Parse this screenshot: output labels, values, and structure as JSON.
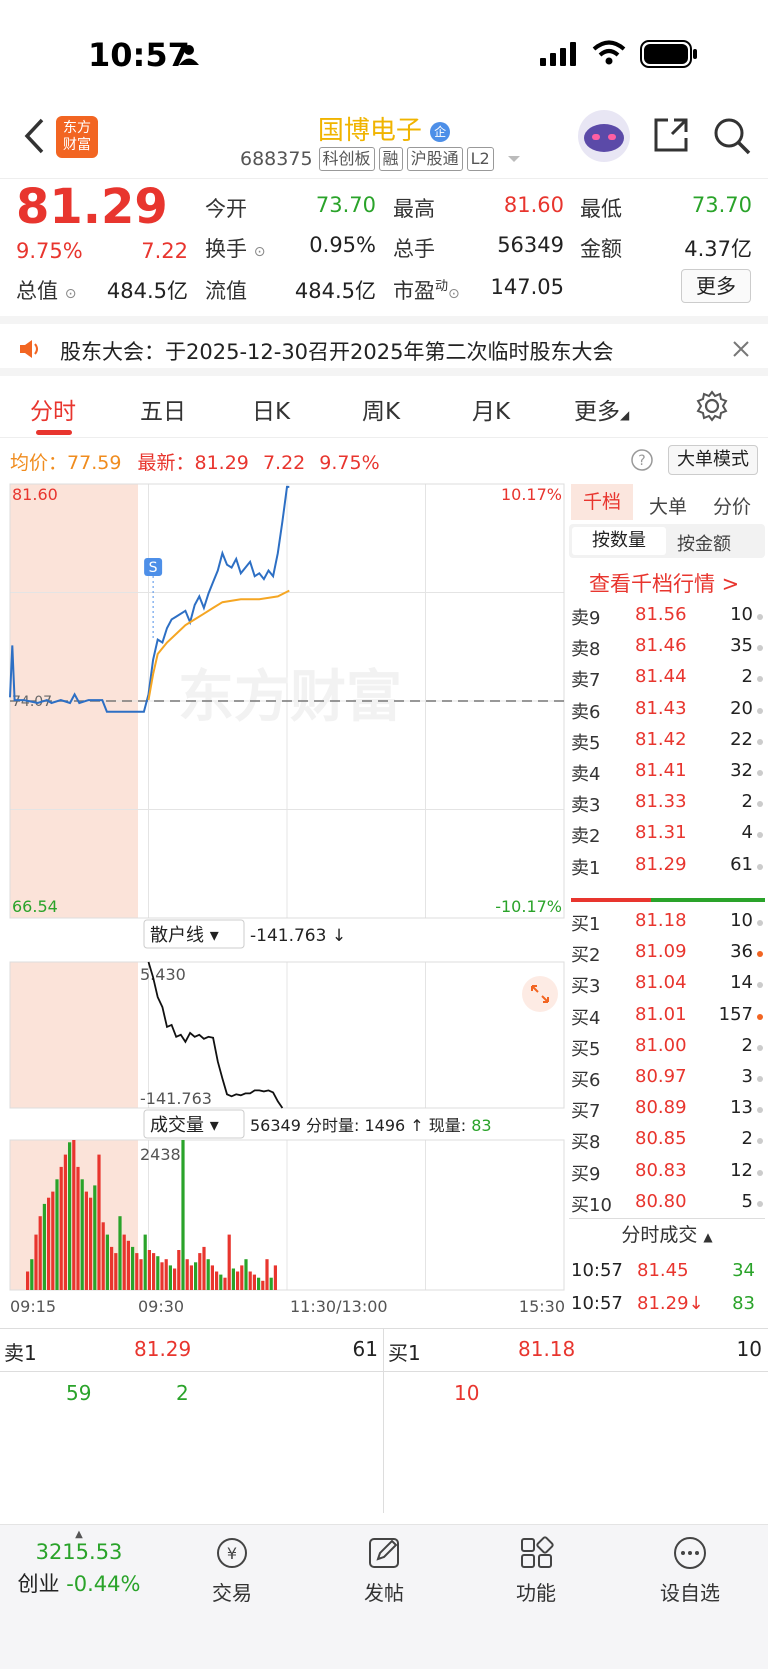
{
  "status_bar": {
    "time": "10:57"
  },
  "header": {
    "logo_text_1": "东方",
    "logo_text_2": "财富",
    "stock_name": "国博电子",
    "stock_code": "688375",
    "tags": [
      "科创板",
      "融",
      "沪股通",
      "L2"
    ]
  },
  "quote": {
    "price": "81.29",
    "change_pct": "9.75%",
    "change": "7.22",
    "open_label": "今开",
    "open": "73.70",
    "high_label": "最高",
    "high": "81.60",
    "low_label": "最低",
    "low": "73.70",
    "turnover_label": "换手",
    "turnover": "0.95%",
    "volume_label": "总手",
    "volume": "56349",
    "amount_label": "金额",
    "amount": "4.37亿",
    "total_cap_label": "总值",
    "total_cap": "484.5亿",
    "float_cap_label": "流值",
    "float_cap": "484.5亿",
    "pe_label": "市盈",
    "pe_sup": "动",
    "pe": "147.05",
    "more_label": "更多"
  },
  "notice": {
    "text": "股东大会：于2025-12-30召开2025年第二次临时股东大会"
  },
  "tabs": [
    "分时",
    "五日",
    "日K",
    "周K",
    "月K",
    "更多"
  ],
  "info_line": {
    "avg_label": "均价：",
    "avg": "77.59",
    "latest_label": "最新：",
    "latest": "81.29",
    "change": "7.22",
    "change_pct": "9.75%",
    "big_order_label": "大单模式"
  },
  "chart_data": [
    {
      "type": "line",
      "ylim": [
        66.54,
        81.6
      ],
      "ref_price": 74.07,
      "y_max_label": "81.60",
      "y_min_label": "66.54",
      "y_ref_label": "74.07",
      "pct_max_label": "10.17%",
      "pct_min_label": "-10.17%",
      "watermark": "东方财富",
      "marker_label": "S",
      "series": [
        {
          "color": "#2d6fc4",
          "values": [
            [
              0,
              74.2
            ],
            [
              0.5,
              76.0
            ],
            [
              1,
              74.1
            ],
            [
              3,
              74.1
            ],
            [
              6,
              74.0
            ],
            [
              8,
              74.1
            ],
            [
              9,
              74.0
            ],
            [
              11,
              74.1
            ],
            [
              13,
              74.0
            ],
            [
              14,
              74.3
            ],
            [
              15,
              74.0
            ],
            [
              17,
              74.1
            ],
            [
              20,
              74.1
            ],
            [
              21,
              73.7
            ],
            [
              25,
              73.7
            ],
            [
              29,
              73.7
            ],
            [
              30,
              74.3
            ],
            [
              31,
              75.5
            ],
            [
              32,
              76.2
            ],
            [
              33,
              76.1
            ],
            [
              34,
              76.6
            ],
            [
              35,
              76.9
            ],
            [
              36,
              77.0
            ],
            [
              38,
              77.2
            ],
            [
              39,
              76.8
            ],
            [
              40,
              77.4
            ],
            [
              41,
              77.7
            ],
            [
              42,
              77.3
            ],
            [
              43,
              77.8
            ],
            [
              44,
              78.2
            ],
            [
              45,
              78.6
            ],
            [
              46,
              79.2
            ],
            [
              47,
              78.8
            ],
            [
              48,
              78.7
            ],
            [
              49,
              79.0
            ],
            [
              50,
              78.5
            ],
            [
              51,
              78.7
            ],
            [
              52,
              78.9
            ],
            [
              53,
              78.4
            ],
            [
              54,
              78.5
            ],
            [
              55,
              78.3
            ],
            [
              56,
              78.6
            ],
            [
              57,
              78.4
            ],
            [
              58,
              79.2
            ],
            [
              59,
              80.3
            ],
            [
              60,
              81.5
            ],
            [
              60.5,
              81.5
            ]
          ]
        },
        {
          "color": "#f5a623",
          "values": [
            [
              30,
              74.1
            ],
            [
              31,
              75.0
            ],
            [
              32,
              75.7
            ],
            [
              34,
              76.1
            ],
            [
              36,
              76.4
            ],
            [
              38,
              76.7
            ],
            [
              40,
              76.9
            ],
            [
              42,
              77.1
            ],
            [
              44,
              77.3
            ],
            [
              46,
              77.5
            ],
            [
              50,
              77.6
            ],
            [
              54,
              77.6
            ],
            [
              58,
              77.7
            ],
            [
              60.5,
              77.9
            ]
          ]
        }
      ]
    },
    {
      "type": "line",
      "title": "散户线",
      "value": "-141.763",
      "y_top_label": "5.430",
      "y_bottom_label": "-141.763",
      "ylim": [
        -141.763,
        5.43
      ],
      "series": [
        {
          "color": "#111111",
          "values": [
            [
              30,
              5.43
            ],
            [
              31,
              -10
            ],
            [
              32,
              -30
            ],
            [
              33,
              -40
            ],
            [
              34,
              -60
            ],
            [
              35,
              -58
            ],
            [
              36,
              -70
            ],
            [
              37,
              -68
            ],
            [
              38,
              -75
            ],
            [
              39,
              -66
            ],
            [
              40,
              -70
            ],
            [
              41,
              -68
            ],
            [
              42,
              -72
            ],
            [
              43,
              -70
            ],
            [
              44,
              -71
            ],
            [
              45,
              -95
            ],
            [
              46,
              -112
            ],
            [
              47,
              -128
            ],
            [
              48,
              -130
            ],
            [
              49,
              -128
            ],
            [
              50,
              -129
            ],
            [
              51,
              -127
            ],
            [
              52,
              -127
            ],
            [
              53,
              -124
            ],
            [
              54,
              -124
            ],
            [
              55,
              -125
            ],
            [
              56,
              -124
            ],
            [
              57,
              -126
            ],
            [
              58,
              -135
            ],
            [
              59,
              -141.763
            ]
          ]
        }
      ]
    },
    {
      "type": "bar",
      "title": "成交量",
      "total": "56349",
      "minute_label": "分时量:",
      "minute_value": "1496",
      "now_label": "现量:",
      "now_value": "83",
      "y_max_label": "2438",
      "x_labels": [
        "09:15",
        "09:30",
        "11:30/13:00",
        "15:30"
      ],
      "ylim": [
        0,
        2438
      ],
      "values": [
        300,
        500,
        900,
        1200,
        1400,
        1500,
        1600,
        1800,
        2000,
        2200,
        2400,
        2438,
        2000,
        1800,
        1600,
        1500,
        1700,
        2200,
        1100,
        900,
        700,
        600,
        1200,
        900,
        800,
        700,
        600,
        500,
        900,
        650,
        600,
        550,
        450,
        500,
        400,
        350,
        650,
        2438,
        500,
        400,
        450,
        600,
        700,
        500,
        400,
        300,
        250,
        200,
        900,
        350,
        300,
        400,
        500,
        300,
        250,
        200,
        150,
        500,
        200,
        400
      ]
    }
  ],
  "side_panel": {
    "tabs": [
      "千档",
      "大单",
      "分价"
    ],
    "sub_tabs": [
      "按数量",
      "按金额"
    ],
    "link": "查看千档行情 >",
    "asks": [
      {
        "label": "卖9",
        "price": "81.56",
        "vol": "10",
        "dot": "gray"
      },
      {
        "label": "卖8",
        "price": "81.46",
        "vol": "35",
        "dot": "gray"
      },
      {
        "label": "卖7",
        "price": "81.44",
        "vol": "2",
        "dot": "gray"
      },
      {
        "label": "卖6",
        "price": "81.43",
        "vol": "20",
        "dot": "gray"
      },
      {
        "label": "卖5",
        "price": "81.42",
        "vol": "22",
        "dot": "gray"
      },
      {
        "label": "卖4",
        "price": "81.41",
        "vol": "32",
        "dot": "gray"
      },
      {
        "label": "卖3",
        "price": "81.33",
        "vol": "2",
        "dot": "gray"
      },
      {
        "label": "卖2",
        "price": "81.31",
        "vol": "4",
        "dot": "gray"
      },
      {
        "label": "卖1",
        "price": "81.29",
        "vol": "61",
        "dot": "gray"
      }
    ],
    "bids": [
      {
        "label": "买1",
        "price": "81.18",
        "vol": "10",
        "dot": "gray"
      },
      {
        "label": "买2",
        "price": "81.09",
        "vol": "36",
        "dot": "orange"
      },
      {
        "label": "买3",
        "price": "81.04",
        "vol": "14",
        "dot": "gray"
      },
      {
        "label": "买4",
        "price": "81.01",
        "vol": "157",
        "dot": "orange"
      },
      {
        "label": "买5",
        "price": "81.00",
        "vol": "2",
        "dot": "gray"
      },
      {
        "label": "买6",
        "price": "80.97",
        "vol": "3",
        "dot": "gray"
      },
      {
        "label": "买7",
        "price": "80.89",
        "vol": "13",
        "dot": "gray"
      },
      {
        "label": "买8",
        "price": "80.85",
        "vol": "2",
        "dot": "gray"
      },
      {
        "label": "买9",
        "price": "80.83",
        "vol": "12",
        "dot": "gray"
      },
      {
        "label": "买10",
        "price": "80.80",
        "vol": "5",
        "dot": "gray"
      }
    ],
    "ticks_title": "分时成交",
    "ticks": [
      {
        "time": "10:57",
        "price": "81.45",
        "vol": "34",
        "arrow": ""
      },
      {
        "time": "10:57",
        "price": "81.29",
        "vol": "83",
        "arrow": "↓"
      }
    ]
  },
  "summary": {
    "sell_label": "卖1",
    "sell_price": "81.29",
    "sell_vol": "61",
    "buy_label": "买1",
    "buy_price": "81.18",
    "buy_vol": "10",
    "sell_detail": [
      "59",
      "2"
    ],
    "buy_detail": [
      "10"
    ]
  },
  "bottom_nav": {
    "index_value": "3215.53",
    "index_name": "创业",
    "index_change": "-0.44%",
    "items": [
      "交易",
      "发帖",
      "功能",
      "设自选"
    ]
  },
  "colors": {
    "up": "#e8352e",
    "down": "#2aa32a",
    "avg_line": "#f5a623",
    "price_line": "#2d6fc4",
    "brand": "#f26522"
  }
}
